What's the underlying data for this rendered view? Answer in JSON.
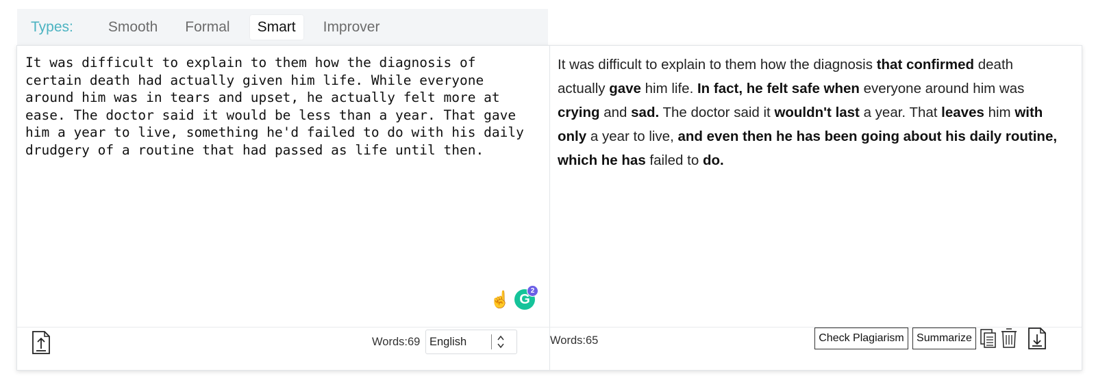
{
  "tabs": {
    "label": "Types:",
    "items": [
      "Smooth",
      "Formal",
      "Smart",
      "Improver"
    ],
    "active": "Smart"
  },
  "input": {
    "text": "It was difficult to explain to them how the diagnosis of certain death had actually given him life. While everyone around him was in tears and upset, he actually felt more at ease. The doctor said it would be less than a year. That gave him a year to live, something he'd failed to do with his daily drudgery of a routine that had passed as life until then.",
    "word_count": "Words:69",
    "language": "English",
    "grammarly_badge": "2",
    "grammarly_letter": "G"
  },
  "output": {
    "segments": [
      {
        "t": "It was difficult to explain to them how the diagnosis ",
        "b": false
      },
      {
        "t": "that confirmed",
        "b": true
      },
      {
        "t": " death actually ",
        "b": false
      },
      {
        "t": "gave",
        "b": true
      },
      {
        "t": " him life. ",
        "b": false
      },
      {
        "t": "In fact, he felt safe when",
        "b": true
      },
      {
        "t": " everyone around him was ",
        "b": false
      },
      {
        "t": "crying",
        "b": true
      },
      {
        "t": " and ",
        "b": false
      },
      {
        "t": "sad.",
        "b": true
      },
      {
        "t": " The doctor said it ",
        "b": false
      },
      {
        "t": "wouldn't last",
        "b": true
      },
      {
        "t": " a year. That ",
        "b": false
      },
      {
        "t": "leaves",
        "b": true
      },
      {
        "t": " him ",
        "b": false
      },
      {
        "t": "with only",
        "b": true
      },
      {
        "t": " a year to live, ",
        "b": false
      },
      {
        "t": "and even then he has been going about his daily routine, which he has",
        "b": true
      },
      {
        "t": " failed to ",
        "b": false
      },
      {
        "t": "do.",
        "b": true
      }
    ],
    "word_count": "Words:65",
    "check_plagiarism_label": "Check Plagiarism",
    "summarize_label": "Summarize"
  },
  "icons": {
    "upload": "upload-file-icon",
    "language_arrows": "chevron-up-down-icon",
    "hand": "pointing-hand-icon",
    "grammarly": "grammarly-icon",
    "copy": "copy-icon",
    "trash": "trash-icon",
    "download": "download-file-icon"
  },
  "colors": {
    "accent": "#4bb3c1",
    "grammarly": "#15c39a",
    "badge": "#6b5fe6"
  }
}
